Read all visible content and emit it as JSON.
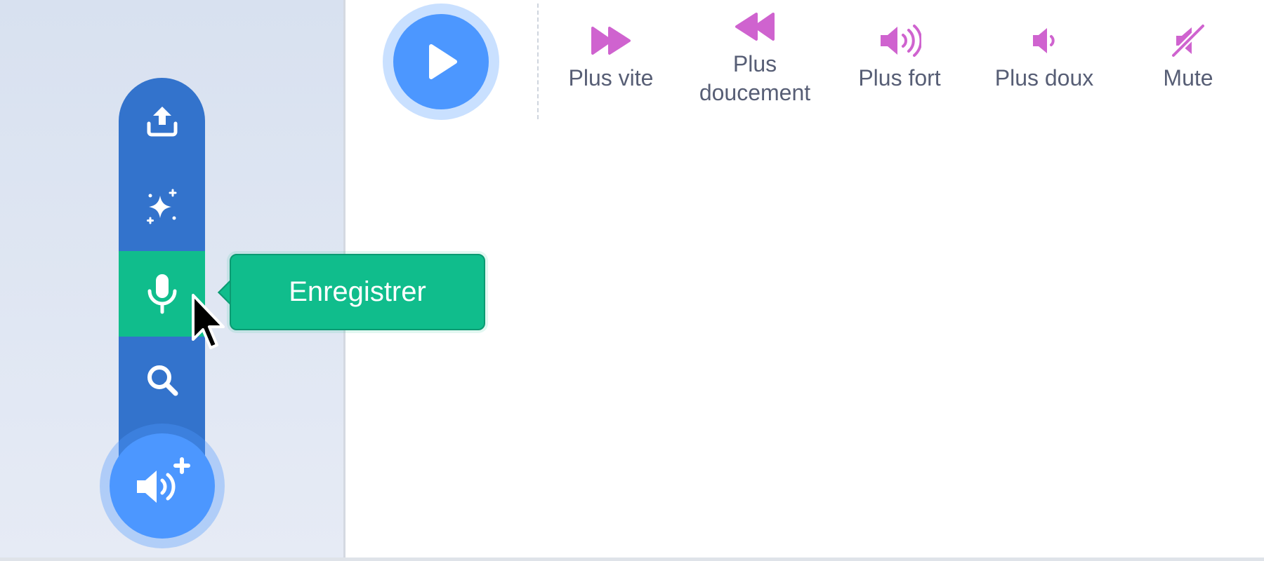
{
  "sound_menu": {
    "items": [
      {
        "id": "upload",
        "icon": "upload-icon"
      },
      {
        "id": "surprise",
        "icon": "sparkles-icon"
      },
      {
        "id": "record",
        "icon": "microphone-icon"
      },
      {
        "id": "choose",
        "icon": "search-icon"
      }
    ],
    "main_icon": "add-sound-icon",
    "tooltip": "Enregistrer"
  },
  "toolbar": {
    "play_icon": "play-icon",
    "effects": [
      {
        "label": "Plus vite",
        "icon": "fast-forward-icon"
      },
      {
        "label": "Plus doucement",
        "icon": "rewind-icon"
      },
      {
        "label": "Plus fort",
        "icon": "volume-up-icon"
      },
      {
        "label": "Plus doux",
        "icon": "volume-down-icon"
      },
      {
        "label": "Mute",
        "icon": "mute-icon"
      }
    ]
  },
  "colors": {
    "menu_blue": "#3373cc",
    "accent_blue": "#4c97ff",
    "record_green": "#10bd8c",
    "effect_magenta": "#cf63cf",
    "label_gray": "#575e75"
  }
}
